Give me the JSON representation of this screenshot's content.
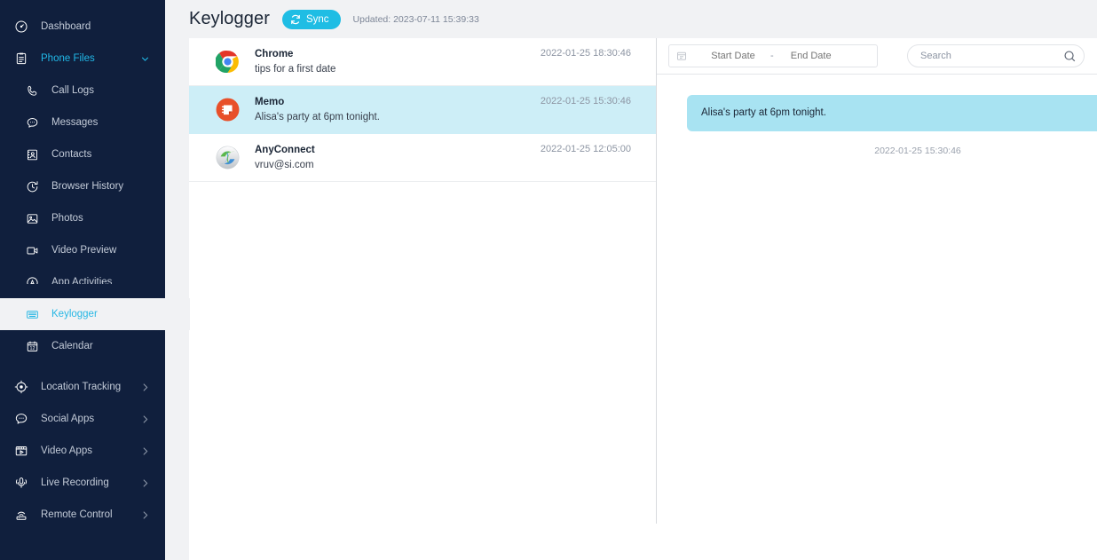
{
  "sidebar": {
    "items": [
      {
        "label": "Dashboard",
        "icon": "dashboard-icon",
        "type": "item",
        "key": "dashboard"
      },
      {
        "label": "Phone Files",
        "icon": "clipboard-icon",
        "type": "group",
        "key": "phone-files",
        "chevron": "chevron-down-icon"
      },
      {
        "label": "Call Logs",
        "icon": "phone-icon",
        "type": "sub",
        "key": "call-logs"
      },
      {
        "label": "Messages",
        "icon": "chat-bubble-icon",
        "type": "sub",
        "key": "messages"
      },
      {
        "label": "Contacts",
        "icon": "contact-card-icon",
        "type": "sub",
        "key": "contacts"
      },
      {
        "label": "Browser History",
        "icon": "history-clock-icon",
        "type": "sub",
        "key": "browser-history"
      },
      {
        "label": "Photos",
        "icon": "photo-icon",
        "type": "sub",
        "key": "photos"
      },
      {
        "label": "Video Preview",
        "icon": "video-camera-icon",
        "type": "sub",
        "key": "video-preview"
      },
      {
        "label": "App Activities",
        "icon": "app-activities-icon",
        "type": "sub",
        "key": "app-activities"
      },
      {
        "label": "Keylogger",
        "icon": "keyboard-icon",
        "type": "sub",
        "key": "keylogger",
        "active": true
      },
      {
        "label": "Calendar",
        "icon": "calendar-icon",
        "type": "sub",
        "key": "calendar"
      },
      {
        "label": "Location Tracking",
        "icon": "target-icon",
        "type": "item",
        "key": "location-tracking",
        "chevron": "chevron-right-icon"
      },
      {
        "label": "Social Apps",
        "icon": "chat-bubble-icon",
        "type": "item",
        "key": "social-apps",
        "chevron": "chevron-right-icon"
      },
      {
        "label": "Video Apps",
        "icon": "film-icon",
        "type": "item",
        "key": "video-apps",
        "chevron": "chevron-right-icon"
      },
      {
        "label": "Live Recording",
        "icon": "microphone-icon",
        "type": "item",
        "key": "live-recording",
        "chevron": "chevron-right-icon"
      },
      {
        "label": "Remote Control",
        "icon": "remote-signal-icon",
        "type": "item",
        "key": "remote-control",
        "chevron": "chevron-right-icon"
      }
    ]
  },
  "header": {
    "title": "Keylogger",
    "sync_label": "Sync",
    "sync_icon": "refresh-icon",
    "updated_text": "Updated: 2023-07-11 15:39:33"
  },
  "list": {
    "rows": [
      {
        "app": "Chrome",
        "text": "tips for a first date",
        "time": "2022-01-25 18:30:46",
        "icon": "chrome-icon",
        "selected": false
      },
      {
        "app": "Memo",
        "text": "Alisa's party at 6pm tonight.",
        "time": "2022-01-25 15:30:46",
        "icon": "memo-icon",
        "selected": true
      },
      {
        "app": "AnyConnect",
        "text": "vruv@si.com",
        "time": "2022-01-25 12:05:00",
        "icon": "anyconnect-icon",
        "selected": false
      }
    ]
  },
  "filters": {
    "calendar_icon": "calendar-icon",
    "start_date_placeholder": "Start Date",
    "start_date_value": "",
    "separator": "-",
    "end_date_placeholder": "End Date",
    "end_date_value": "",
    "search_placeholder": "Search",
    "search_value": "",
    "search_icon": "search-icon"
  },
  "detail": {
    "message_text": "Alisa's party at 6pm tonight.",
    "message_time": "2022-01-25 15:30:46"
  },
  "colors": {
    "sidebar_bg": "#101f3d",
    "accent": "#1fbde4",
    "selected_row": "#cdeef7",
    "bubble": "#a8e3f2",
    "page_bg": "#f1f2f4"
  }
}
